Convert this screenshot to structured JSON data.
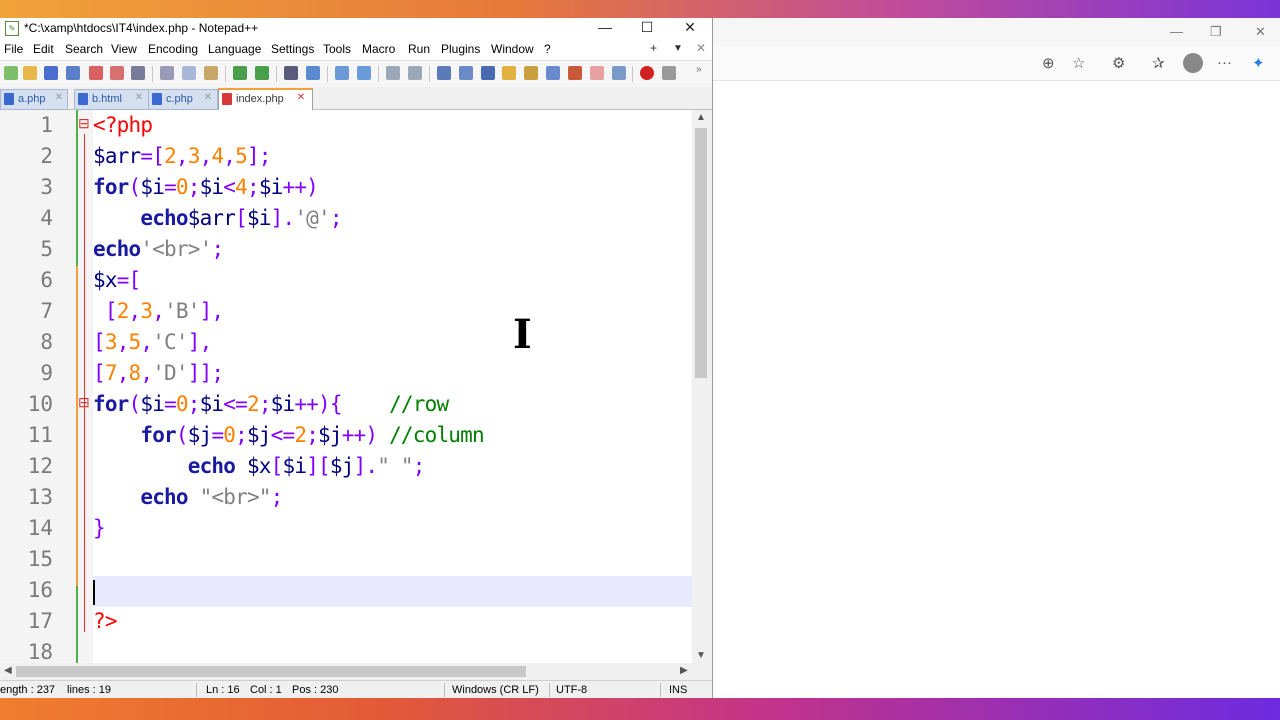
{
  "window": {
    "title": "*C:\\xamp\\htdocs\\IT4\\index.php - Notepad++",
    "minimize": "—",
    "maximize": "☐",
    "close": "✕"
  },
  "menu": [
    "File",
    "Edit",
    "Search",
    "View",
    "Encoding",
    "Language",
    "Settings",
    "Tools",
    "Macro",
    "Run",
    "Plugins",
    "Window",
    "?"
  ],
  "menu_right": {
    "add": "+",
    "dropdown": "▼",
    "close": "✕"
  },
  "tabs": [
    {
      "label": "a.php",
      "active": false
    },
    {
      "label": "b.html",
      "active": false
    },
    {
      "label": "c.php",
      "active": false
    },
    {
      "label": "index.php",
      "active": true
    }
  ],
  "tab_close": "✕",
  "editor": {
    "line_numbers": [
      "1",
      "2",
      "3",
      "4",
      "5",
      "6",
      "7",
      "8",
      "9",
      "10",
      "11",
      "12",
      "13",
      "14",
      "15",
      "16",
      "17",
      "18"
    ],
    "fold_minus": "⊟"
  },
  "status": {
    "length": "ength : 237",
    "lines": "lines : 19",
    "ln": "Ln : 16",
    "col": "Col : 1",
    "pos": "Pos : 230",
    "eol": "Windows (CR LF)",
    "encoding": "UTF-8",
    "mode": "INS"
  },
  "browser": {
    "min": "—",
    "restore": "❐",
    "close": "✕",
    "zoom_icon": "⊕",
    "fav_icon": "☆",
    "ext_icon": "⚙",
    "favs_icon": "✰",
    "more_icon": "···",
    "copilot_icon": "✦"
  },
  "colors": {
    "keyword": "#1a1aa0",
    "number": "#ff8000",
    "string": "#808080",
    "comment": "#008000",
    "tag": "#ff0000",
    "variable": "#000080",
    "operator": "#8000ff"
  }
}
